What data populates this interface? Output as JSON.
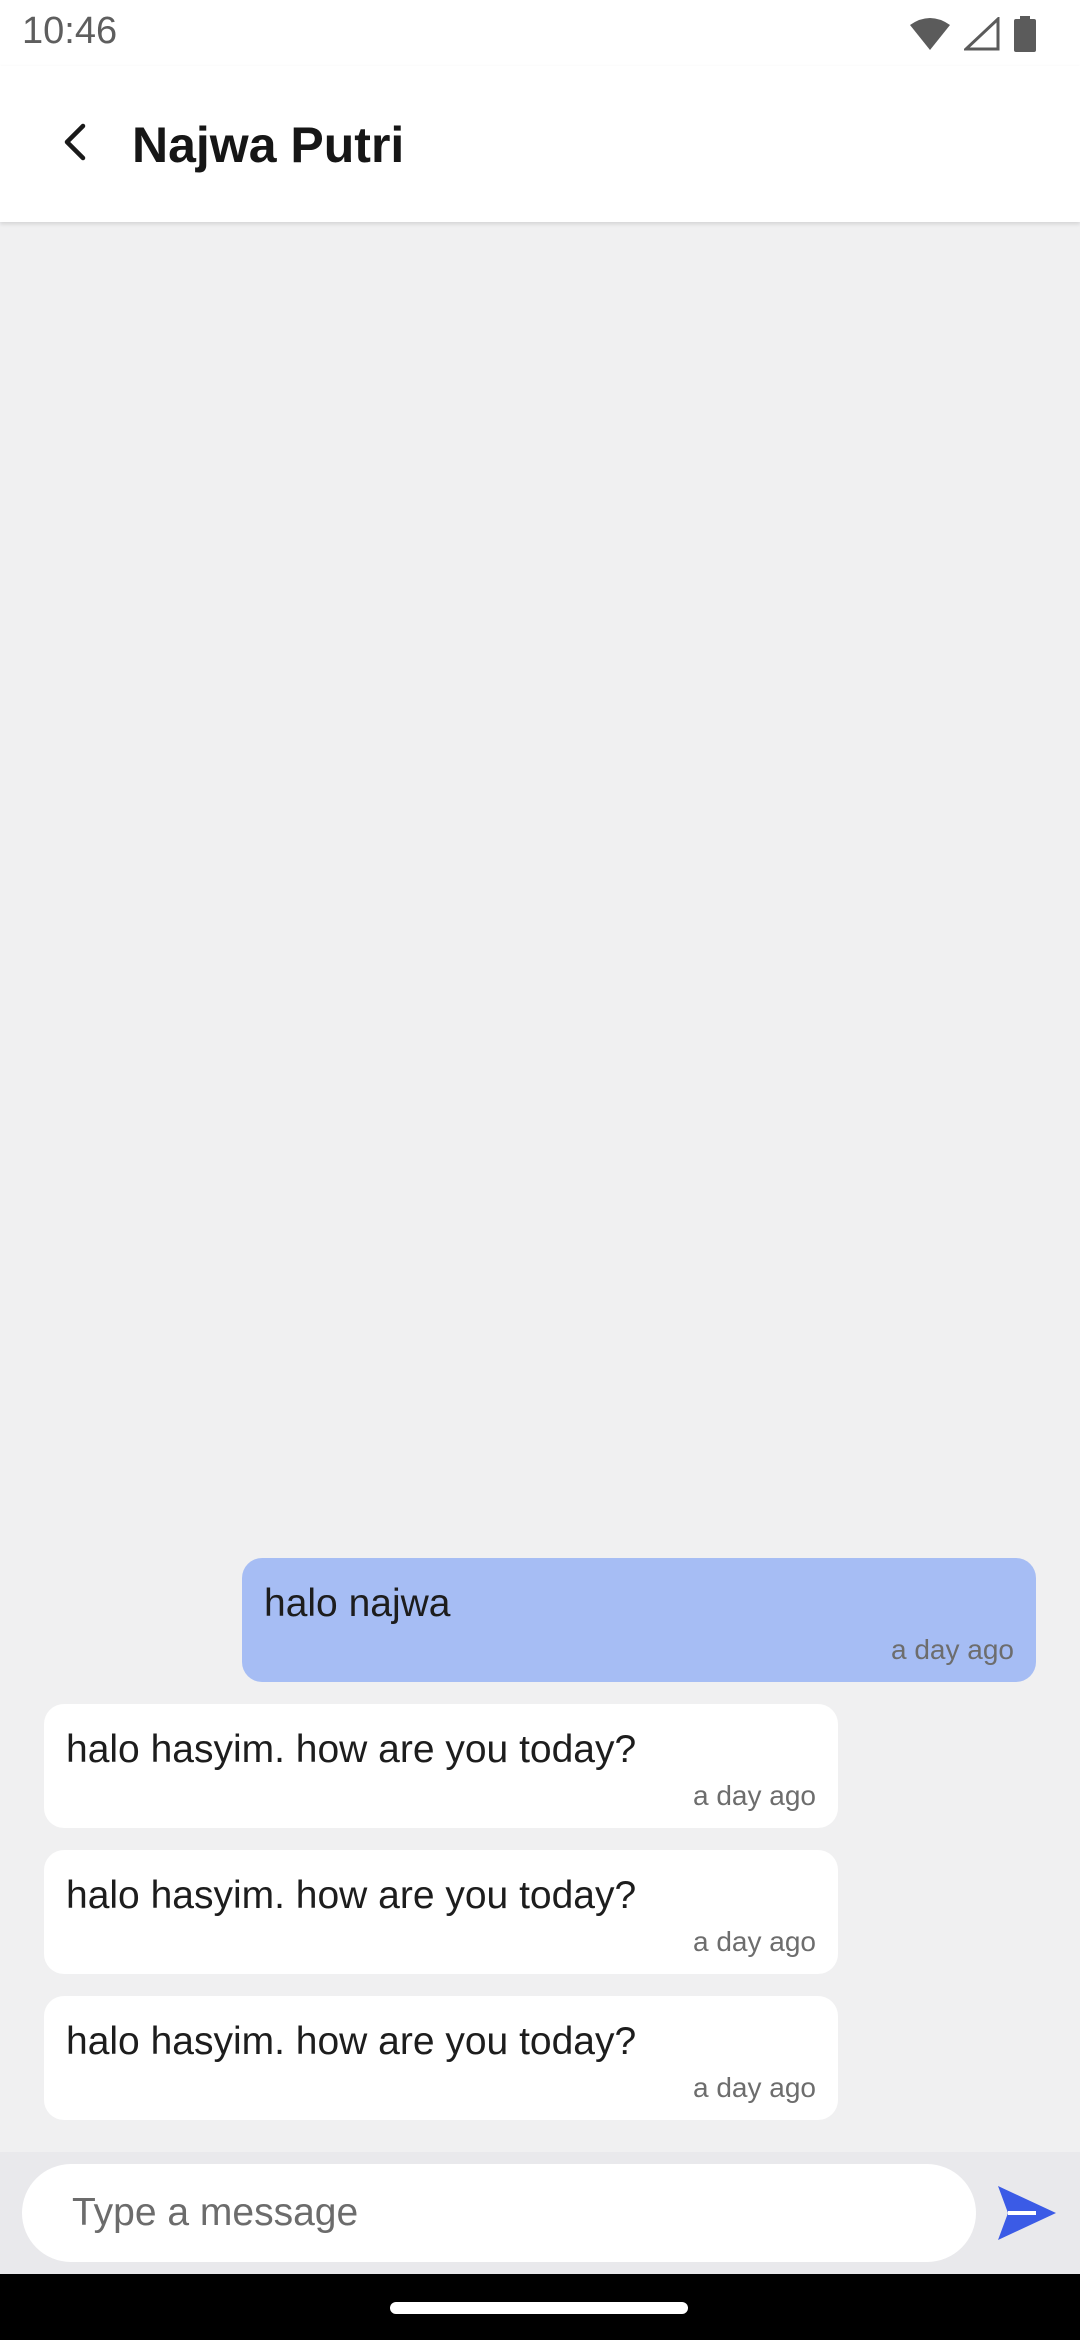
{
  "status_bar": {
    "time": "10:46",
    "icons": [
      "wifi-icon",
      "cellular-signal-icon",
      "battery-icon"
    ]
  },
  "header": {
    "back_icon": "back-arrow-icon",
    "title": "Najwa Putri"
  },
  "messages": [
    {
      "direction": "sent",
      "text": "halo najwa",
      "time": "a day ago"
    },
    {
      "direction": "received",
      "text": "halo hasyim. how are you today?",
      "time": "a day ago"
    },
    {
      "direction": "received",
      "text": "halo hasyim. how are you today?",
      "time": "a day ago"
    },
    {
      "direction": "received",
      "text": "halo hasyim. how are you today?",
      "time": "a day ago"
    }
  ],
  "composer": {
    "placeholder": "Type a message",
    "value": "",
    "send_icon": "send-icon"
  },
  "colors": {
    "sent_bubble": "#a6bdf4",
    "received_bubble": "#ffffff",
    "background": "#f0f0f1",
    "send_accent": "#3b5be6"
  }
}
